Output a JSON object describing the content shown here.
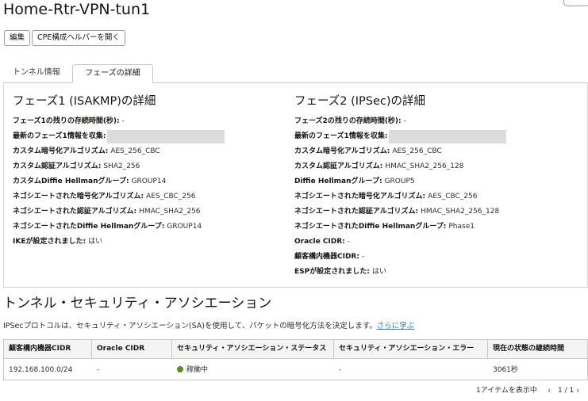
{
  "header": {
    "title": "Home-Rtr-VPN-tun1",
    "more_label": "···"
  },
  "toolbar": {
    "edit_label": "編集",
    "cpe_helper_label": "CPE構成ヘルパーを開く"
  },
  "tabs": [
    {
      "label": "トンネル情報",
      "active": false
    },
    {
      "label": "フェーズの詳細",
      "active": true
    }
  ],
  "phase1": {
    "title": "フェーズ1 (ISAKMP)の詳細",
    "rows": [
      {
        "key": "フェーズ1の残りの存続時間(秒):",
        "value": "-"
      },
      {
        "key": "最新のフェーズ1情報を収集:",
        "value": ""
      },
      {
        "key": "カスタム暗号化アルゴリズム:",
        "value": "AES_256_CBC"
      },
      {
        "key": "カスタム認証アルゴリズム:",
        "value": "SHA2_256"
      },
      {
        "key": "カスタムDiffie Hellmanグループ:",
        "value": "GROUP14"
      },
      {
        "key": "ネゴシエートされた暗号化アルゴリズム:",
        "value": "AES_CBC_256"
      },
      {
        "key": "ネゴシエートされた認証アルゴリズム:",
        "value": "HMAC_SHA2_256"
      },
      {
        "key": "ネゴシエートされたDiffie Hellmanグループ:",
        "value": "GROUP14"
      },
      {
        "key": "IKEが設定されました:",
        "value": "はい"
      }
    ]
  },
  "phase2": {
    "title": "フェーズ2 (IPSec)の詳細",
    "rows": [
      {
        "key": "フェーズ2の残りの存続時間(秒):",
        "value": "-"
      },
      {
        "key": "最新のフェーズ1情報を収集:",
        "value": ""
      },
      {
        "key": "カスタム暗号化アルゴリズム:",
        "value": "AES_256_CBC"
      },
      {
        "key": "カスタム認証アルゴリズム:",
        "value": "HMAC_SHA2_256_128"
      },
      {
        "key": "Diffie Hellmanグループ:",
        "value": "GROUP5"
      },
      {
        "key": "ネゴシエートされた暗号化アルゴリズム:",
        "value": "AES_CBC_256"
      },
      {
        "key": "ネゴシエートされた認証アルゴリズム:",
        "value": "HMAC_SHA2_256_128"
      },
      {
        "key": "ネゴシエートされたDiffie Hellmanグループ:",
        "value": "Phase1"
      },
      {
        "key": "Oracle CIDR:",
        "value": "-"
      },
      {
        "key": "顧客構内機器CIDR:",
        "value": "-"
      },
      {
        "key": "ESPが設定されました:",
        "value": "はい"
      }
    ]
  },
  "sa_section": {
    "title": "トンネル・セキュリティ・アソシエーション",
    "description": "IPSecプロトコルは、セキュリティ・アソシエーション(SA)を使用して、パケットの暗号化方法を決定します。",
    "learn_more": "さらに学ぶ"
  },
  "sa_table": {
    "columns": [
      "顧客構内機器CIDR",
      "Oracle CIDR",
      "セキュリティ・アソシエーション・ステータス",
      "セキュリティ・アソシエーション・エラー",
      "現在の状態の継続時間"
    ],
    "rows": [
      {
        "cpe_cidr": "192.168.100.0/24",
        "oracle_cidr": "-",
        "status": "稼働中",
        "error": "-",
        "duration": "3061秒"
      }
    ],
    "status_color": "#5b8d21"
  },
  "pagination": {
    "info": "1アイテムを表示中",
    "page": "1 / 1"
  }
}
